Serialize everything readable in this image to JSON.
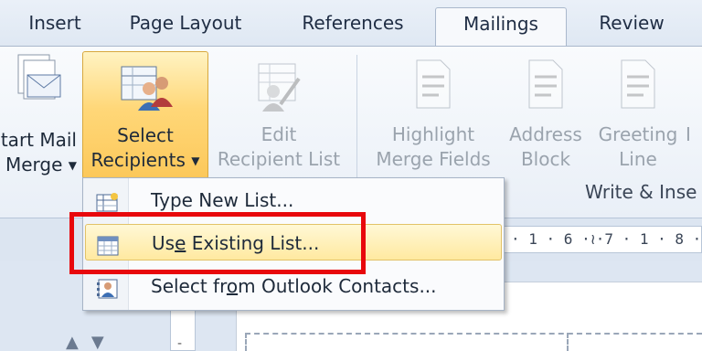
{
  "tabs": [
    {
      "label": "Insert",
      "active": false
    },
    {
      "label": "Page Layout",
      "active": false
    },
    {
      "label": "References",
      "active": false
    },
    {
      "label": "Mailings",
      "active": true
    },
    {
      "label": "Review",
      "active": false
    }
  ],
  "ribbon": {
    "start_mail_merge": {
      "line1": "tart Mail",
      "line2": "Merge",
      "icon": "envelope-stack-icon"
    },
    "select_recipients": {
      "line1": "Select",
      "line2": "Recipients",
      "icon": "recipients-people-icon"
    },
    "edit_recipient_list": {
      "line1": "Edit",
      "line2": "Recipient List",
      "icon": "edit-list-icon"
    },
    "highlight_merge_fields": {
      "line1": "Highlight",
      "line2": "Merge Fields",
      "icon": "highlight-fields-icon"
    },
    "address_block": {
      "line1": "Address",
      "line2": "Block",
      "icon": "address-block-icon"
    },
    "greeting_line": {
      "line1": "Greeting",
      "line2": "Line",
      "icon": "greeting-line-icon"
    },
    "insert_cut": {
      "line1": "I"
    },
    "group_label": "Write & Inse"
  },
  "ruler_text": "· 1 · 6 ·≀·7 · 1 · 8 · 1 ·",
  "menu": {
    "items": [
      {
        "pre": "Type New List...",
        "u": "",
        "post": "",
        "icon": "new-list-icon",
        "highlighted": false
      },
      {
        "pre": "Us",
        "u": "e",
        "post": " Existing List...",
        "icon": "existing-list-icon",
        "highlighted": true
      },
      {
        "pre": "Select fr",
        "u": "o",
        "post": "m Outlook Contacts...",
        "icon": "outlook-contacts-icon",
        "highlighted": false
      }
    ]
  },
  "doc": {
    "vruler_mark": "-"
  },
  "colors": {
    "highlight_box": "#e8080c",
    "hot_button": "#ffd778",
    "menu_hover": "#ffe9a0"
  }
}
